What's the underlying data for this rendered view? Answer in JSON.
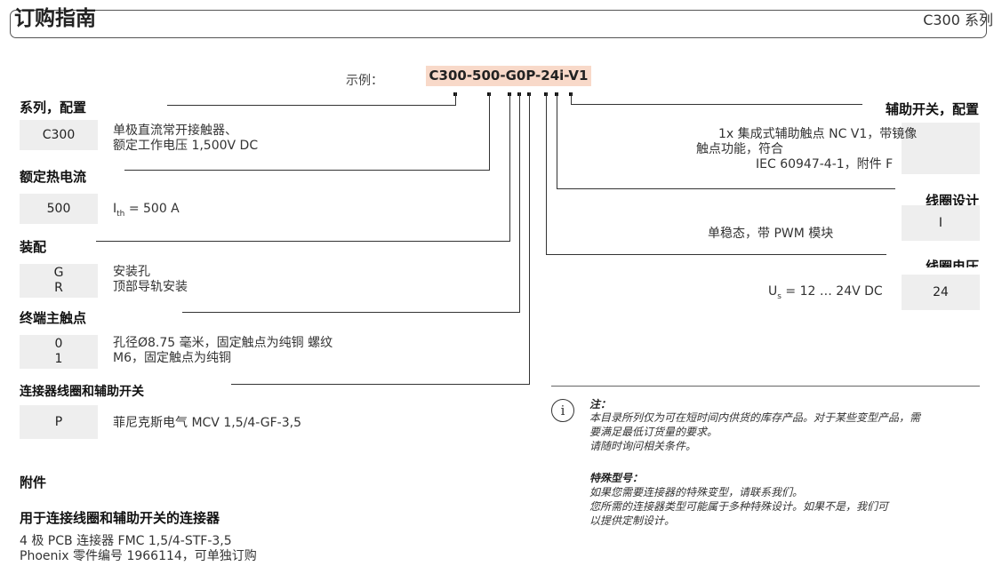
{
  "header": {
    "title": "订购指南",
    "series": "C300 系列"
  },
  "example": {
    "label": "示例：",
    "code": "C300-500-G0P-24i-V1"
  },
  "left": {
    "series": {
      "heading": "系列，配置",
      "code": "C300",
      "desc": [
        "单极直流常开接触器、",
        "额定工作电压 1,500V DC"
      ]
    },
    "current": {
      "heading": "额定热电流",
      "code": "500",
      "desc_sub": "th",
      "desc_prefix": "I",
      "desc_suffix": " = 500 A"
    },
    "mounting": {
      "heading": "装配",
      "codes": [
        "G",
        "R"
      ],
      "desc": [
        "安装孔",
        "顶部导轨安装"
      ]
    },
    "terminal": {
      "heading": "终端主触点",
      "codes": [
        "0",
        "1"
      ],
      "desc": [
        "孔径Ø8.75 毫米，固定触点为纯铜 螺纹",
        "M6，固定触点为纯铜"
      ]
    },
    "connector": {
      "heading": "连接器线圈和辅助开关",
      "code": "P",
      "desc": "菲尼克斯电气 MCV 1,5/4-GF-3,5"
    }
  },
  "accessories": {
    "heading": "附件",
    "subheading": "用于连接线圈和辅助开关的连接器",
    "lines": [
      "4 极 PCB 连接器 FMC 1,5/4-STF-3,5",
      "Phoenix 零件编号 1966114，可单独订购"
    ]
  },
  "right": {
    "aux": {
      "heading": "辅助开关，配置",
      "code": "",
      "desc": [
        "1x 集成式辅助触点 NC V1，带镜像",
        "触点功能，符合",
        "IEC 60947-4-1，附件 F"
      ]
    },
    "coil_design": {
      "heading": "线圈设计",
      "code": "I",
      "desc": "单稳态，带 PWM 模块"
    },
    "coil_voltage": {
      "heading": "线圈电压",
      "code": "24",
      "desc_prefix": "U",
      "desc_sub": "s",
      "desc_suffix": " = 12 … 24V DC"
    }
  },
  "note": {
    "title": "注：",
    "lines": [
      "本目录所列仅为可在短时间内供货的库存产品。对于某些变型产品，需",
      "要满足最低订货量的要求。",
      "请随时询问相关条件。"
    ],
    "special_title": "特殊型号：",
    "special_lines": [
      "如果您需要连接器的特殊变型，请联系我们。",
      "您所需的连接器类型可能属于多种特殊设计。如果不是，我们可",
      "以提供定制设计。"
    ]
  }
}
